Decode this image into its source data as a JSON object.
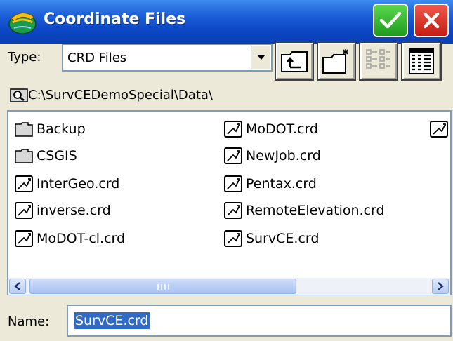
{
  "window": {
    "title": "Coordinate Files",
    "ok_icon": "checkmark-icon",
    "close_icon": "close-icon",
    "colors": {
      "titlebar": "#0b46c4",
      "ok": "#2fb02f",
      "close": "#d8261c"
    }
  },
  "type_filter": {
    "label": "Type:",
    "selected": "CRD Files"
  },
  "toolbar": {
    "buttons": [
      "up-folder-icon",
      "new-folder-icon",
      "list-view-icon",
      "details-view-icon"
    ]
  },
  "path": {
    "text": "C:\\SurvCEDemoSpecial\\Data\\",
    "icon": "folder-search-icon"
  },
  "files": {
    "items": [
      {
        "name": "Backup",
        "kind": "folder"
      },
      {
        "name": "CSGIS",
        "kind": "folder"
      },
      {
        "name": "InterGeo.crd",
        "kind": "file"
      },
      {
        "name": "inverse.crd",
        "kind": "file"
      },
      {
        "name": "MoDOT-cl.crd",
        "kind": "file"
      },
      {
        "name": "MoDOT.crd",
        "kind": "file"
      },
      {
        "name": "NewJob.crd",
        "kind": "file"
      },
      {
        "name": "Pentax.crd",
        "kind": "file"
      },
      {
        "name": "RemoteElevation.crd",
        "kind": "file"
      },
      {
        "name": "SurvCE.crd",
        "kind": "file"
      }
    ]
  },
  "name_field": {
    "label": "Name:",
    "value": "SurvCE.crd"
  }
}
